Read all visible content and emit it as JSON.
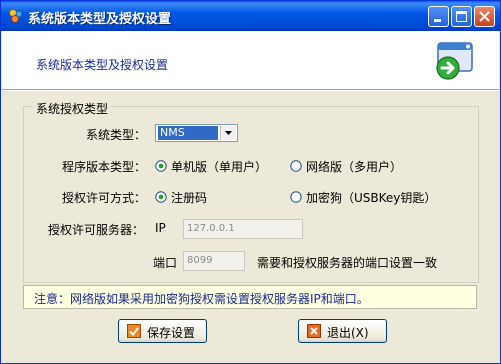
{
  "window": {
    "title": "系统版本类型及授权设置"
  },
  "header": {
    "title": "系统版本类型及授权设置"
  },
  "group": {
    "legend": "系统授权类型",
    "system_type": {
      "label": "系统类型：",
      "value": "NMS"
    },
    "edition": {
      "label": "程序版本类型：",
      "options": [
        {
          "label": "单机版（单用户）",
          "selected": true
        },
        {
          "label": "网络版（多用户）",
          "selected": false
        }
      ]
    },
    "license_mode": {
      "label": "授权许可方式：",
      "options": [
        {
          "label": "注册码",
          "selected": true
        },
        {
          "label": "加密狗（USBKey钥匙）",
          "selected": false
        }
      ]
    },
    "license_server": {
      "label": "授权许可服务器：",
      "ip_label": "IP",
      "ip_value": "127.0.0.1",
      "port_label": "端口",
      "port_value": "8099",
      "port_hint": "需要和授权服务器的端口设置一致"
    }
  },
  "note": "注意：网络版如果采用加密狗授权需设置授权服务器IP和端口。",
  "buttons": {
    "save": "保存设置",
    "exit": "退出(X)"
  }
}
